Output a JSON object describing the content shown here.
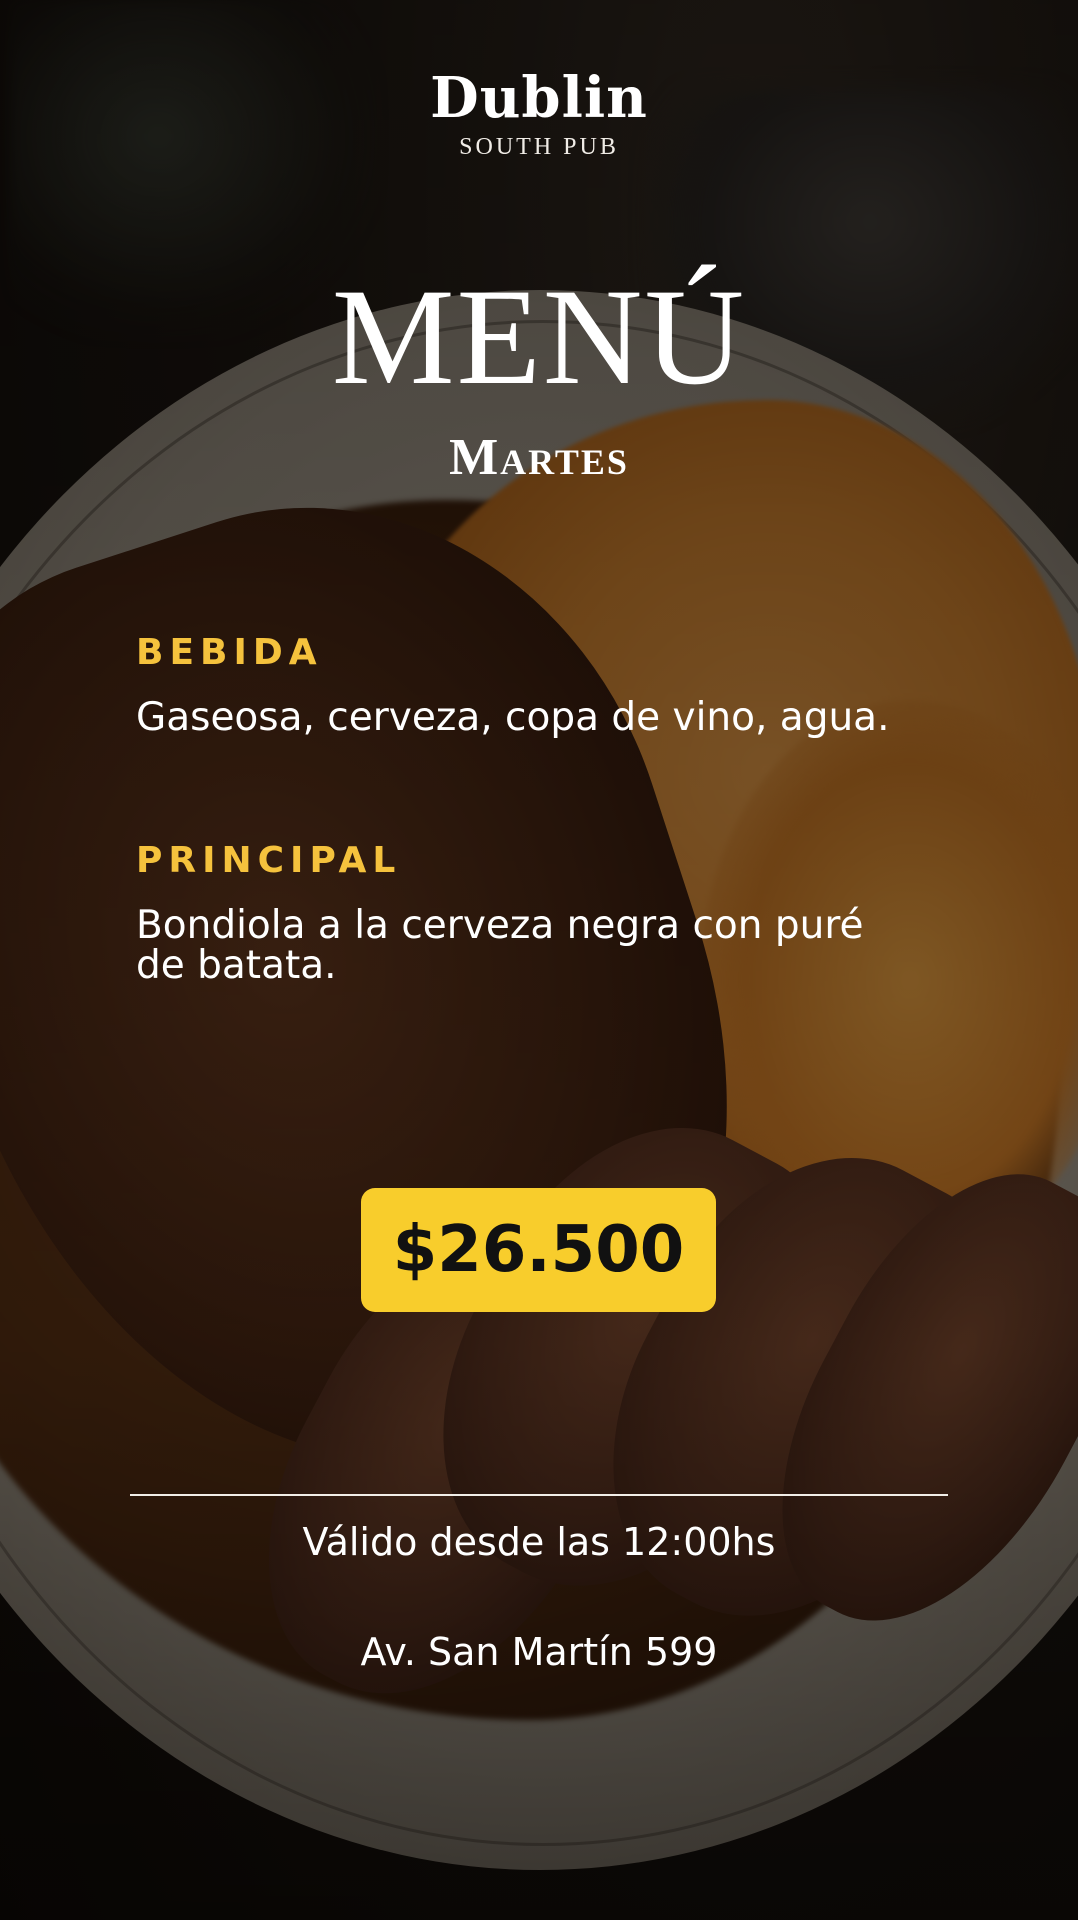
{
  "brand": {
    "name": "Dublin",
    "subtitle": "SOUTH PUB"
  },
  "menu": {
    "title": "MENÚ",
    "day": "Martes"
  },
  "sections": {
    "bebida": {
      "label": "BEBIDA",
      "text": "Gaseosa, cerveza, copa de vino, agua."
    },
    "principal": {
      "label": "PRINCIPAL",
      "text": "Bondiola a la cerveza negra con puré de batata."
    }
  },
  "price": "$26.500",
  "footer": {
    "validity": "Válido desde las 12:00hs",
    "address": "Av. San Martín 599"
  },
  "colors": {
    "accent": "#f5c23d",
    "price_badge": "#f8cd2c",
    "text": "#ffffff"
  }
}
